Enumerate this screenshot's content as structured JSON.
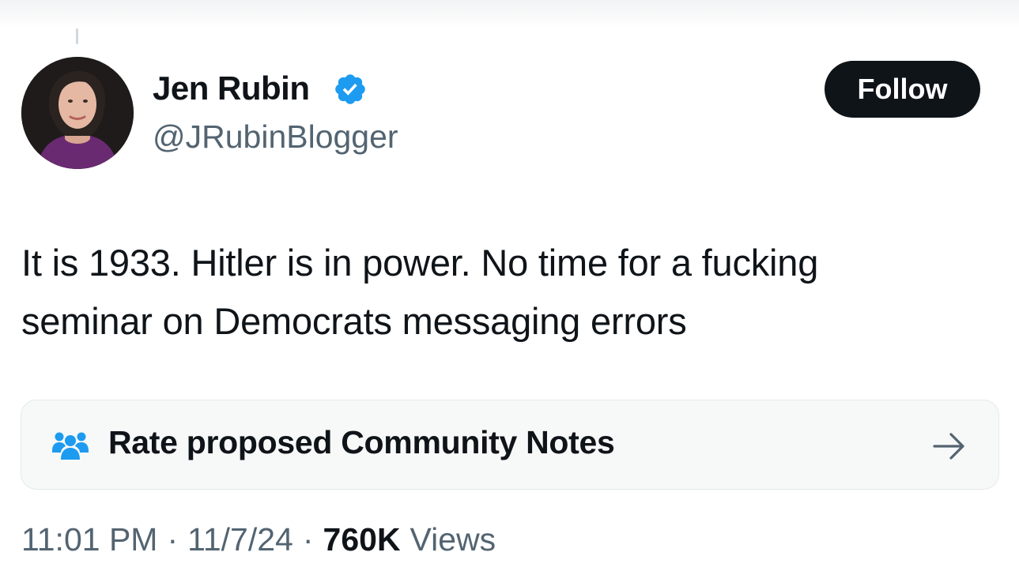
{
  "author": {
    "display_name": "Jen Rubin",
    "handle": "@JRubinBlogger",
    "verified_icon": "verified-badge-icon",
    "avatar_icon": "profile-photo"
  },
  "actions": {
    "follow_label": "Follow"
  },
  "tweet": {
    "text_line1": "It is 1933. Hitler is in power. No time for a fucking",
    "text_line2": "seminar on Democrats messaging errors"
  },
  "community_notes": {
    "label": "Rate proposed Community Notes",
    "icon": "people-icon",
    "arrow_icon": "arrow-right-icon"
  },
  "meta": {
    "time": "11:01 PM",
    "separator": "·",
    "date": "11/7/24",
    "views_count": "760K",
    "views_label": "Views"
  },
  "colors": {
    "text_primary": "#0f1419",
    "text_secondary": "#536471",
    "verified_blue": "#1d9bf0",
    "card_background": "#f7f9f9"
  }
}
